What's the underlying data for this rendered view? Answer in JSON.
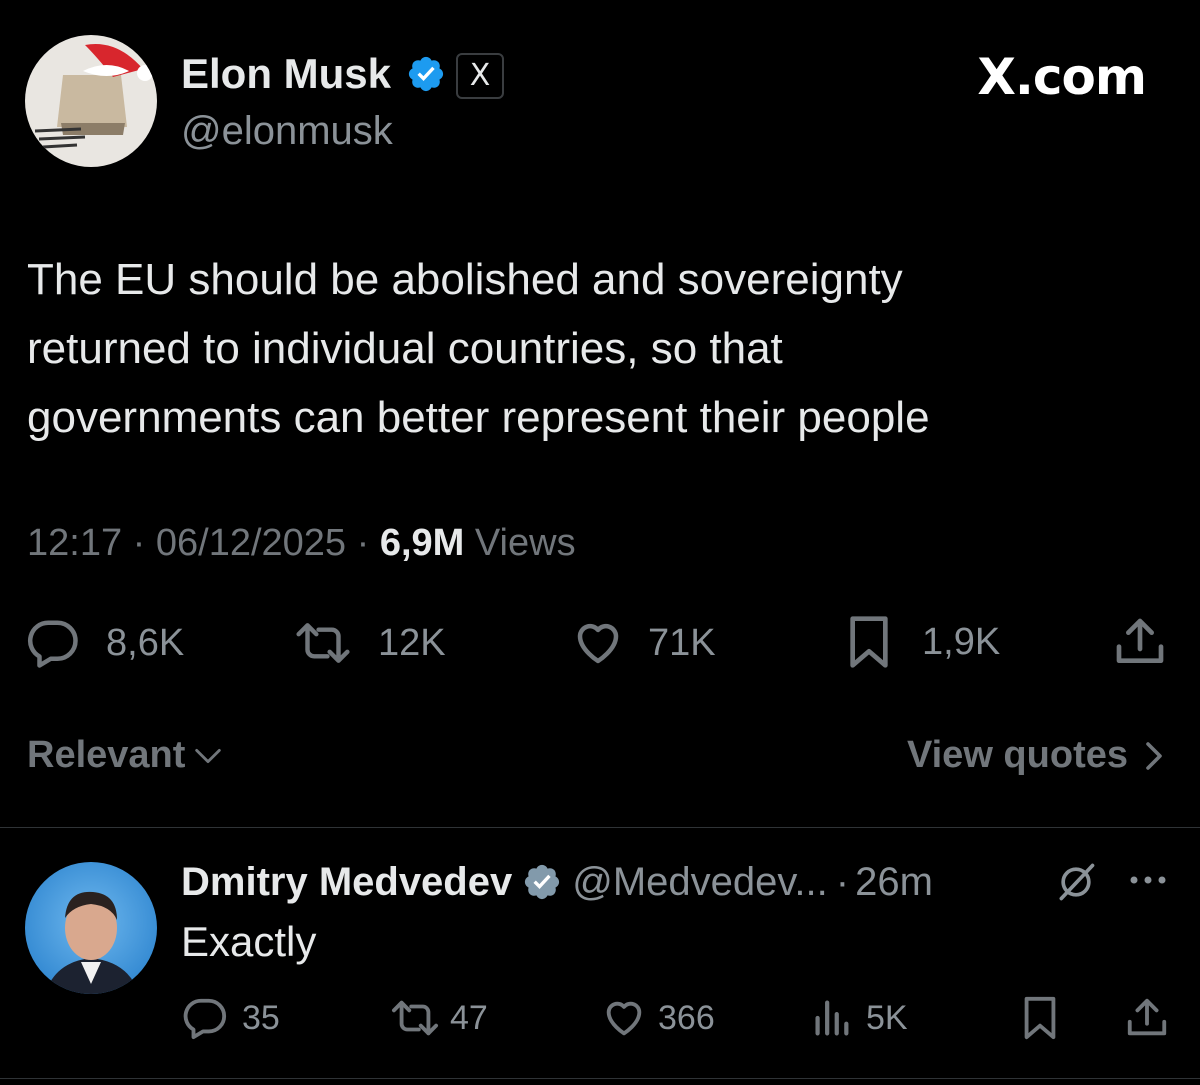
{
  "brand": {
    "site_label": "X.com"
  },
  "post": {
    "author": {
      "name": "Elon Musk",
      "handle": "@elonmusk",
      "verified": true,
      "affiliate_badge": "X"
    },
    "text_lines": [
      "The EU should be abolished and sovereignty",
      "returned to individual countries, so that",
      "governments can better represent their people"
    ],
    "meta": {
      "time": "12:17",
      "sep1": "·",
      "date": "06/12/2025",
      "sep2": "·",
      "views_count": "6,9M",
      "views_label": "Views"
    },
    "actions": {
      "replies": "8,6K",
      "reposts": "12K",
      "likes": "71K",
      "bookmarks": "1,9K"
    }
  },
  "replies_bar": {
    "sort_label": "Relevant",
    "view_quotes_label": "View quotes"
  },
  "reply": {
    "author": {
      "name": "Dmitry Medvedev",
      "handle": "@Medvedev...",
      "verified": true
    },
    "sep": "·",
    "time": "26m",
    "text": "Exactly",
    "actions": {
      "replies": "35",
      "reposts": "47",
      "likes": "366",
      "views": "5K"
    }
  },
  "colors": {
    "background": "#000000",
    "text": "#e7e9ea",
    "muted": "#71767b",
    "verified_blue": "#1d9bf0",
    "verified_gray": "#829aab"
  }
}
